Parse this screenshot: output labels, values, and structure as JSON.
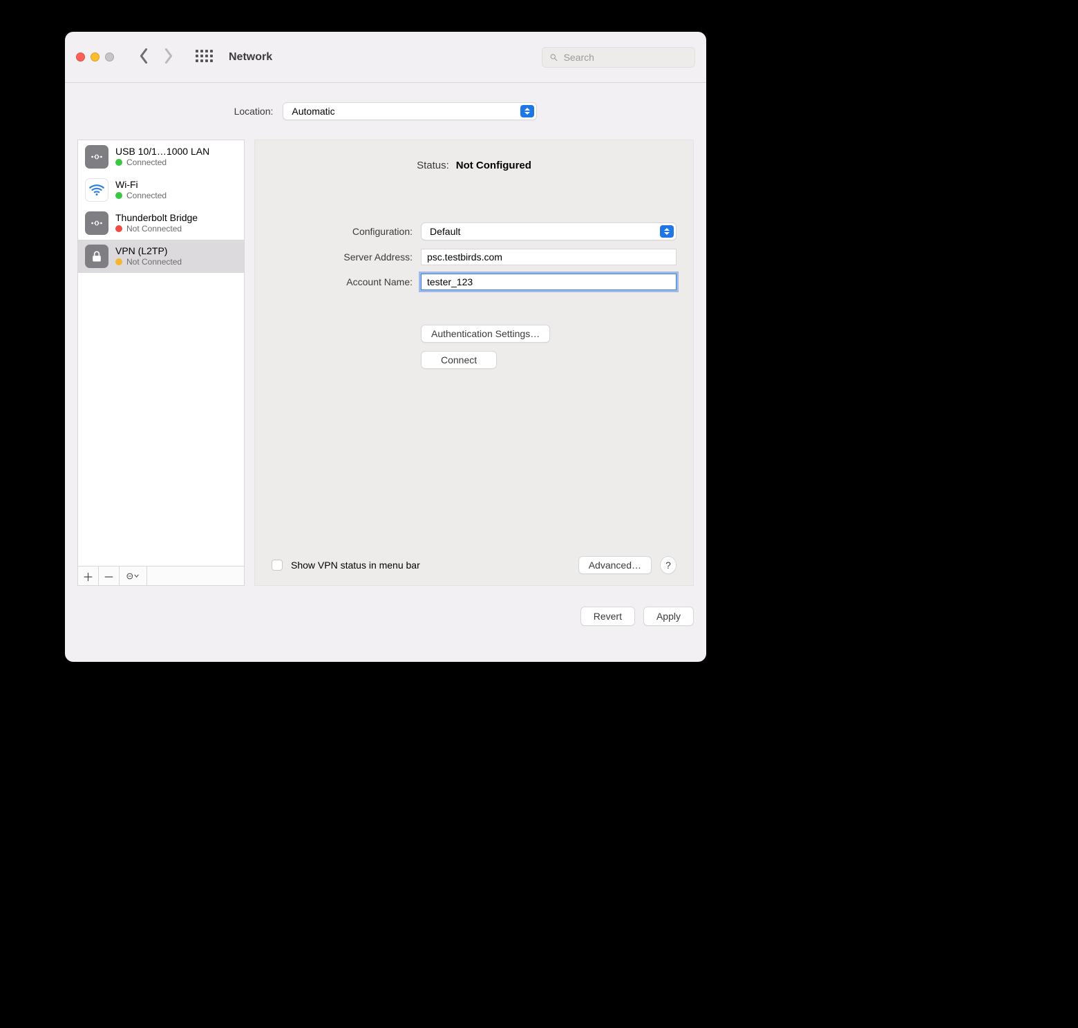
{
  "window": {
    "title": "Network",
    "search_placeholder": "Search"
  },
  "location": {
    "label": "Location:",
    "value": "Automatic"
  },
  "interfaces": [
    {
      "name": "USB 10/1…1000 LAN",
      "status": "Connected",
      "dot": "sd-green",
      "icon": "eth",
      "selected": false
    },
    {
      "name": "Wi-Fi",
      "status": "Connected",
      "dot": "sd-green",
      "icon": "wifi",
      "selected": false
    },
    {
      "name": "Thunderbolt Bridge",
      "status": "Not Connected",
      "dot": "sd-red",
      "icon": "eth",
      "selected": false
    },
    {
      "name": "VPN (L2TP)",
      "status": "Not Connected",
      "dot": "sd-amber",
      "icon": "lock",
      "selected": true
    }
  ],
  "detail": {
    "status_label": "Status:",
    "status_value": "Not Configured",
    "configuration_label": "Configuration:",
    "configuration_value": "Default",
    "server_address_label": "Server Address:",
    "server_address_value": "psc.testbirds.com",
    "account_name_label": "Account Name:",
    "account_name_value": "tester_123",
    "auth_settings_btn": "Authentication Settings…",
    "connect_btn": "Connect",
    "show_status_label": "Show VPN status in menu bar",
    "advanced_btn": "Advanced…",
    "help_btn": "?"
  },
  "actions": {
    "revert": "Revert",
    "apply": "Apply"
  }
}
